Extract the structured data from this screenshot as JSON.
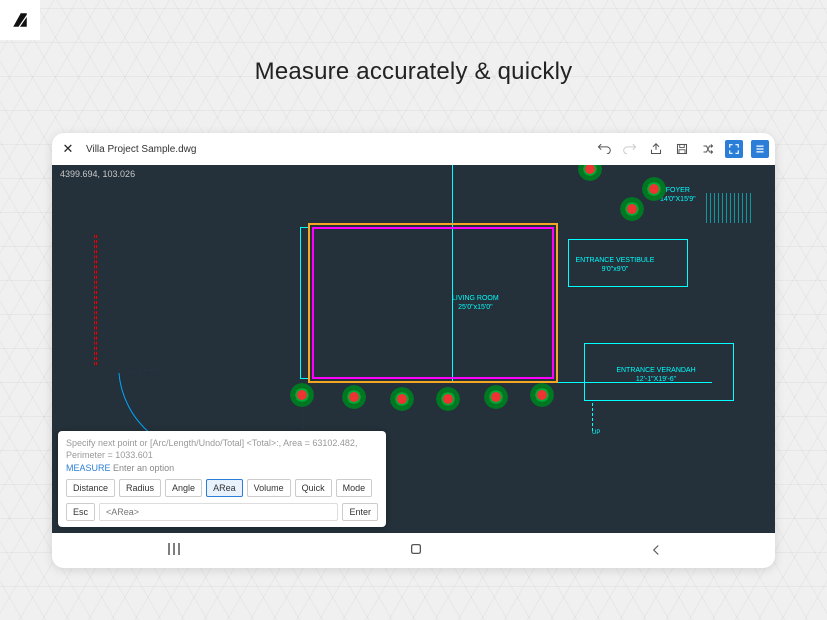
{
  "tagline": "Measure accurately & quickly",
  "titlebar": {
    "filename": "Villa Project Sample.dwg"
  },
  "canvas": {
    "coords": "4399.694, 103.026",
    "labels": {
      "living_room": "LIVING ROOM",
      "living_dim": "25'0\"x15'0\"",
      "vestibule": "ENTRANCE VESTIBULE",
      "vestibule_dim": "9'0\"x9'0\"",
      "foyer": "FOYER",
      "foyer_dim": "14'0\"X15'9\"",
      "verandah": "ENTRANCE VERANDAH",
      "verandah_dim": "12'-1\"X19'-6\"",
      "up": "UP"
    }
  },
  "cmd": {
    "prompt_line": "Specify next point or [Arc/Length/Undo/Total] <Total>:, Area = 63102.482, Perimeter = 1033.601",
    "measure_label": "MEASURE",
    "subtext": "Enter an option",
    "options": {
      "distance": "Distance",
      "radius": "Radius",
      "angle": "Angle",
      "area": "ARea",
      "volume": "Volume",
      "quick": "Quick",
      "mode": "Mode"
    },
    "esc_label": "Esc",
    "input_placeholder": "<ARea>",
    "enter_label": "Enter"
  }
}
